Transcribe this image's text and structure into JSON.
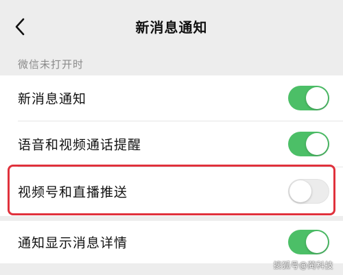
{
  "header": {
    "title": "新消息通知",
    "back_icon": "chevron-left-icon"
  },
  "section": {
    "header": "微信未打开时"
  },
  "settings": [
    {
      "label": "新消息通知",
      "enabled": true
    },
    {
      "label": "语音和视频通话提醒",
      "enabled": true
    },
    {
      "label": "视频号和直播推送",
      "enabled": false
    },
    {
      "label": "通知显示消息详情",
      "enabled": true
    }
  ],
  "colors": {
    "toggle_on": "#4cbf67",
    "toggle_off": "#ececec",
    "highlight": "#e0313c",
    "background": "#ededed"
  },
  "watermark": "搜狐号@蔺科技"
}
